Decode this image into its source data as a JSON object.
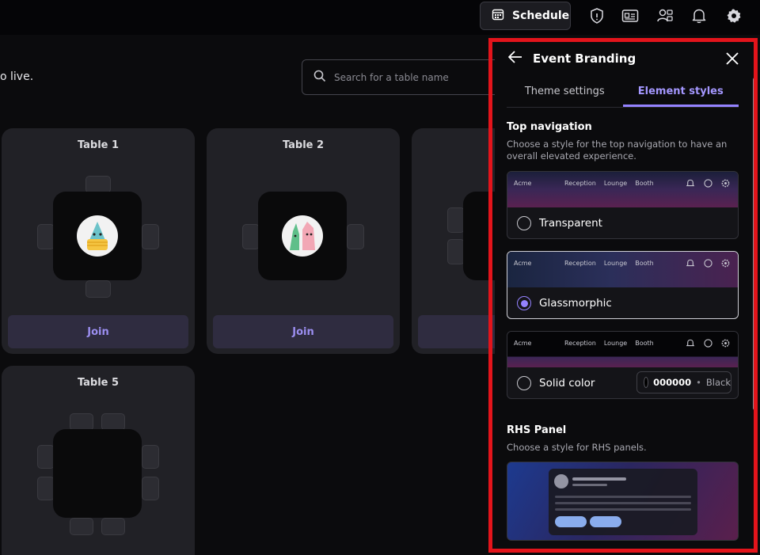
{
  "topbar": {
    "schedule_label": "Schedule",
    "icons": [
      "shield-icon",
      "id-card-icon",
      "people-icon",
      "bell-icon",
      "gear-icon"
    ]
  },
  "main": {
    "tagline": "o live.",
    "search_placeholder": "Search for a table name",
    "tables": [
      {
        "name": "Table 1",
        "join_label": "Join"
      },
      {
        "name": "Table 2",
        "join_label": "Join"
      },
      {
        "name": "Table 5"
      }
    ]
  },
  "panel": {
    "title": "Event Branding",
    "tabs": [
      {
        "label": "Theme settings",
        "active": false
      },
      {
        "label": "Element styles",
        "active": true
      }
    ],
    "top_navigation": {
      "title": "Top navigation",
      "description": "Choose a style for the top navigation to have an overall elevated experience.",
      "preview": {
        "brand": "Acme",
        "links": [
          "Reception",
          "Lounge",
          "Booth"
        ]
      },
      "options": [
        {
          "label": "Transparent",
          "selected": false
        },
        {
          "label": "Glassmorphic",
          "selected": true
        },
        {
          "label": "Solid color",
          "selected": false,
          "color_hex": "000000",
          "color_sep": "•",
          "color_name": "Black"
        }
      ]
    },
    "rhs_panel": {
      "title": "RHS Panel",
      "description": "Choose a style for RHS panels."
    }
  },
  "colors": {
    "accent": "#9482ff",
    "highlight_outline": "#e3141b",
    "background": "#0b0b0d"
  }
}
